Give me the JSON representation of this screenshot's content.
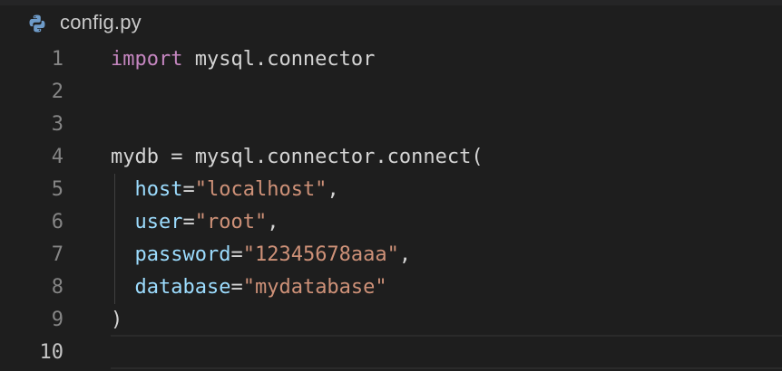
{
  "tab": {
    "filename": "config.py",
    "icon": "python-icon"
  },
  "colors": {
    "background": "#1e1e1e",
    "keyword": "#c586c0",
    "string": "#ce9178",
    "parameter": "#9cdcfe",
    "text": "#d4d4d4",
    "line_number": "#858585"
  },
  "lines": [
    {
      "number": "1",
      "kw": "import",
      "rest": " mysql.connector"
    },
    {
      "number": "2"
    },
    {
      "number": "3"
    },
    {
      "number": "4",
      "text": "mydb = mysql.connector.connect("
    },
    {
      "number": "5",
      "indent": "  ",
      "param": "host",
      "eq": "=",
      "str": "\"localhost\"",
      "tail": ","
    },
    {
      "number": "6",
      "indent": "  ",
      "param": "user",
      "eq": "=",
      "str": "\"root\"",
      "tail": ","
    },
    {
      "number": "7",
      "indent": "  ",
      "param": "password",
      "eq": "=",
      "str": "\"12345678aaa\"",
      "tail": ","
    },
    {
      "number": "8",
      "indent": "  ",
      "param": "database",
      "eq": "=",
      "str": "\"mydatabase\""
    },
    {
      "number": "9",
      "text": ")"
    },
    {
      "number": "10",
      "current": true
    }
  ]
}
